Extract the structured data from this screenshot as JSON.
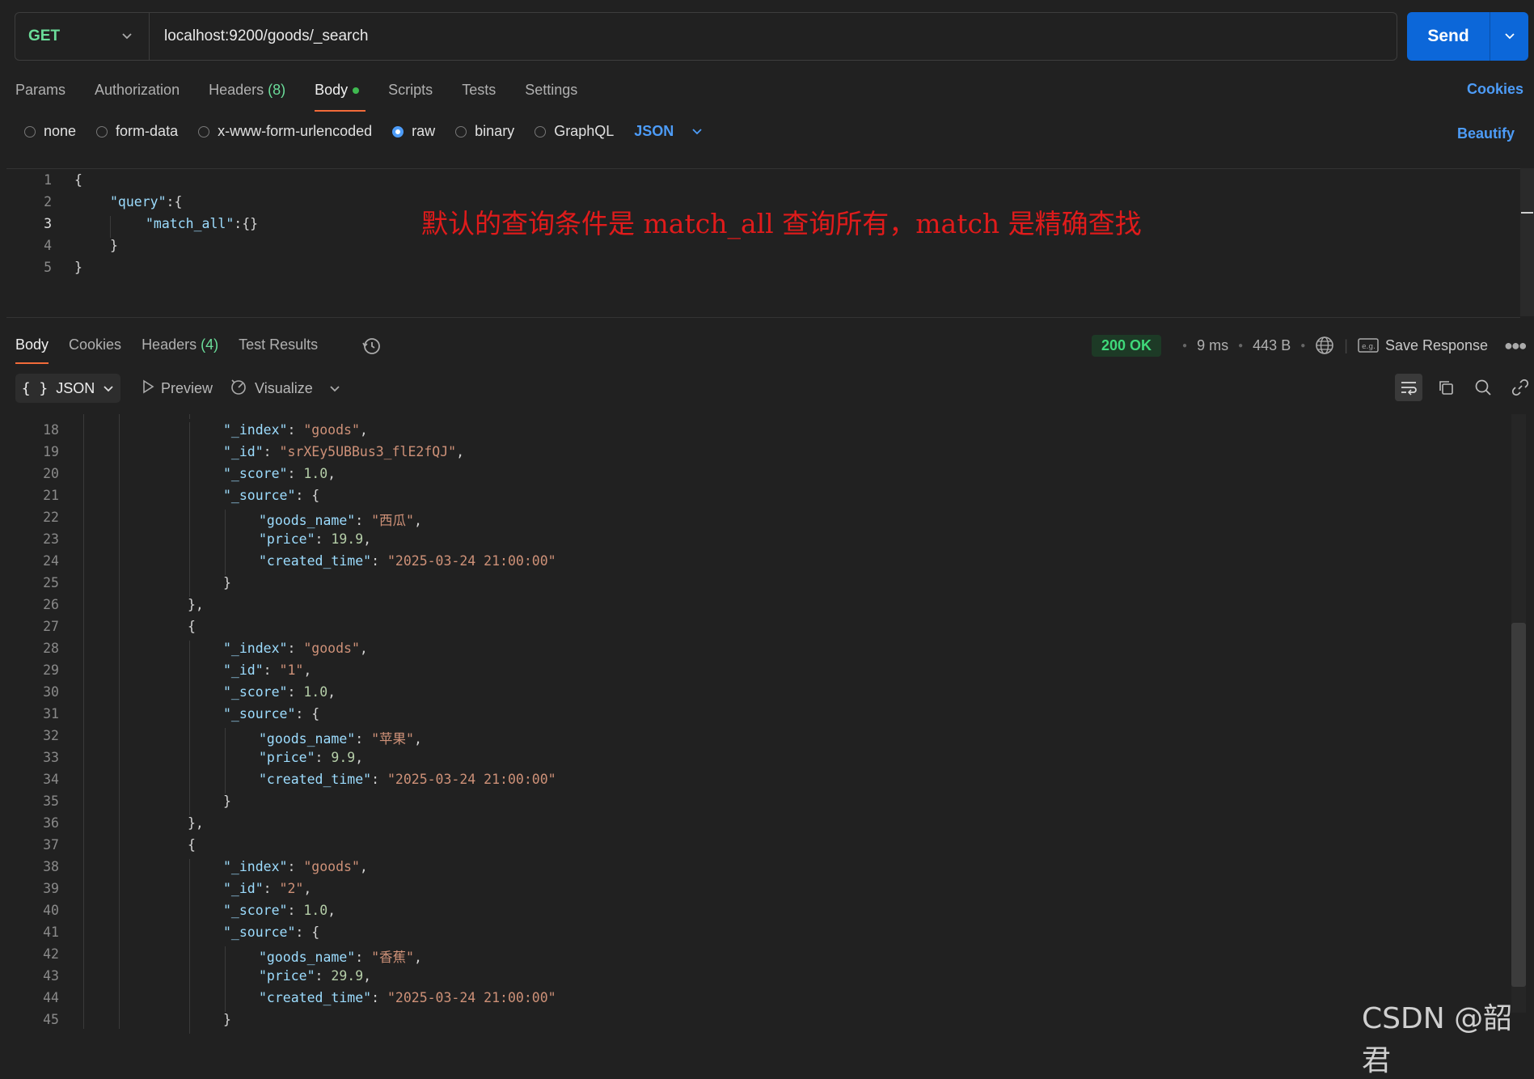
{
  "request": {
    "method": "GET",
    "url": "localhost:9200/goods/_search",
    "send_label": "Send"
  },
  "request_tabs": [
    {
      "label": "Params"
    },
    {
      "label": "Authorization"
    },
    {
      "label": "Headers",
      "count": "(8)"
    },
    {
      "label": "Body",
      "active": true
    },
    {
      "label": "Scripts"
    },
    {
      "label": "Tests"
    },
    {
      "label": "Settings"
    }
  ],
  "cookies_label": "Cookies",
  "body_types": [
    "none",
    "form-data",
    "x-www-form-urlencoded",
    "raw",
    "binary",
    "GraphQL"
  ],
  "body_type_selected": "raw",
  "body_format": "JSON",
  "beautify_label": "Beautify",
  "request_body_lines": [
    {
      "n": "1",
      "t": "{"
    },
    {
      "n": "2",
      "t": "\"query\":{"
    },
    {
      "n": "3",
      "t": "\"match_all\":{}"
    },
    {
      "n": "4",
      "t": "}"
    },
    {
      "n": "5",
      "t": "}"
    }
  ],
  "annotation": "默认的查询条件是 match_all 查询所有，match 是精确查找",
  "response_tabs": [
    {
      "label": "Body",
      "active": true
    },
    {
      "label": "Cookies"
    },
    {
      "label": "Headers",
      "count": "(4)"
    },
    {
      "label": "Test Results"
    }
  ],
  "response_status": {
    "status": "200 OK",
    "time": "9 ms",
    "size": "443 B",
    "save_label": "Save Response"
  },
  "response_toolbar": {
    "format": "JSON",
    "preview": "Preview",
    "visualize": "Visualize"
  },
  "response_lines": [
    {
      "n": "18",
      "k": "\"_index\"",
      "v": "\"goods\"",
      "vt": "str",
      "tail": ","
    },
    {
      "n": "19",
      "k": "\"_id\"",
      "v": "\"srXEy5UBBus3_flE2fQJ\"",
      "vt": "str",
      "tail": ","
    },
    {
      "n": "20",
      "k": "\"_score\"",
      "v": "1.0",
      "vt": "num",
      "tail": ","
    },
    {
      "n": "21",
      "k": "\"_source\"",
      "v": "{",
      "vt": "punc",
      "tail": ""
    },
    {
      "n": "22",
      "k": "\"goods_name\"",
      "v": "\"西瓜\"",
      "vt": "str",
      "tail": ","
    },
    {
      "n": "23",
      "k": "\"price\"",
      "v": "19.9",
      "vt": "num",
      "tail": ","
    },
    {
      "n": "24",
      "k": "\"created_time\"",
      "v": "\"2025-03-24 21:00:00\"",
      "vt": "str",
      "tail": ""
    },
    {
      "n": "25",
      "p": "}"
    },
    {
      "n": "26",
      "p": "},"
    },
    {
      "n": "27",
      "p": "{"
    },
    {
      "n": "28",
      "k": "\"_index\"",
      "v": "\"goods\"",
      "vt": "str",
      "tail": ","
    },
    {
      "n": "29",
      "k": "\"_id\"",
      "v": "\"1\"",
      "vt": "str",
      "tail": ","
    },
    {
      "n": "30",
      "k": "\"_score\"",
      "v": "1.0",
      "vt": "num",
      "tail": ","
    },
    {
      "n": "31",
      "k": "\"_source\"",
      "v": "{",
      "vt": "punc",
      "tail": ""
    },
    {
      "n": "32",
      "k": "\"goods_name\"",
      "v": "\"苹果\"",
      "vt": "str",
      "tail": ","
    },
    {
      "n": "33",
      "k": "\"price\"",
      "v": "9.9",
      "vt": "num",
      "tail": ","
    },
    {
      "n": "34",
      "k": "\"created_time\"",
      "v": "\"2025-03-24 21:00:00\"",
      "vt": "str",
      "tail": ""
    },
    {
      "n": "35",
      "p": "}"
    },
    {
      "n": "36",
      "p": "},"
    },
    {
      "n": "37",
      "p": "{"
    },
    {
      "n": "38",
      "k": "\"_index\"",
      "v": "\"goods\"",
      "vt": "str",
      "tail": ","
    },
    {
      "n": "39",
      "k": "\"_id\"",
      "v": "\"2\"",
      "vt": "str",
      "tail": ","
    },
    {
      "n": "40",
      "k": "\"_score\"",
      "v": "1.0",
      "vt": "num",
      "tail": ","
    },
    {
      "n": "41",
      "k": "\"_source\"",
      "v": "{",
      "vt": "punc",
      "tail": ""
    },
    {
      "n": "42",
      "k": "\"goods_name\"",
      "v": "\"香蕉\"",
      "vt": "str",
      "tail": ","
    },
    {
      "n": "43",
      "k": "\"price\"",
      "v": "29.9",
      "vt": "num",
      "tail": ","
    },
    {
      "n": "44",
      "k": "\"created_time\"",
      "v": "\"2025-03-24 21:00:00\"",
      "vt": "str",
      "tail": ""
    },
    {
      "n": "45",
      "p": "}"
    }
  ],
  "watermark": "CSDN @韶君",
  "colors": {
    "accent": "#0c67d9",
    "method": "#6bdd9a",
    "tab_underline": "#f26b3a",
    "annotation": "#e01b1b"
  }
}
